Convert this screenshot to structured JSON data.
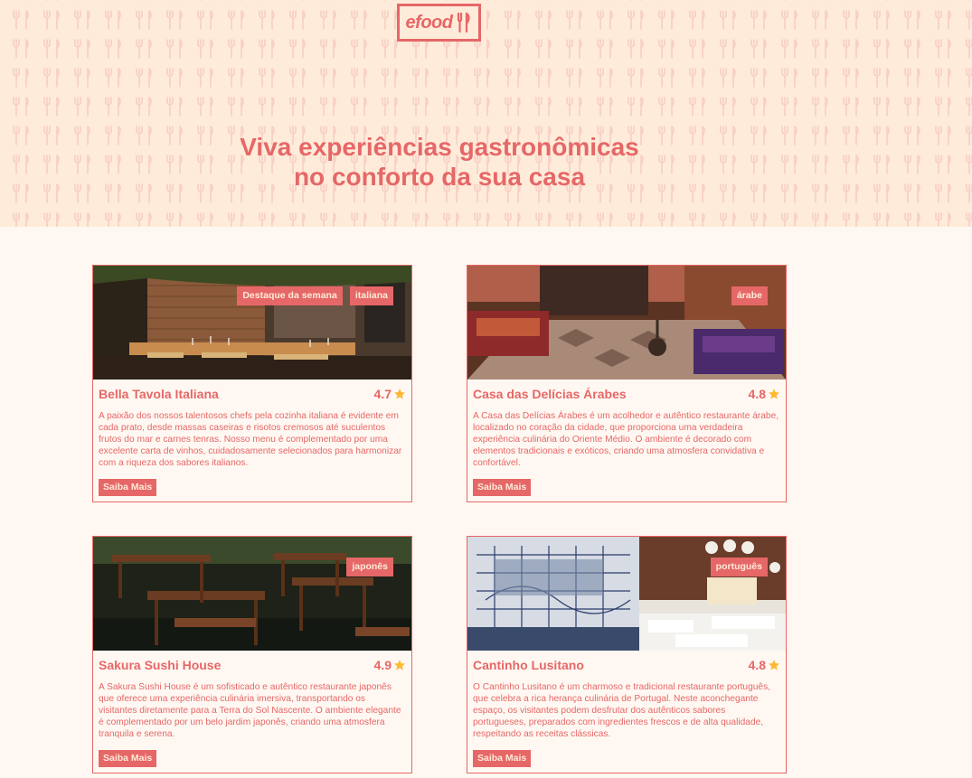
{
  "header": {
    "logo_text": "efood",
    "tagline_line1": "Viva experiências gastronômicas",
    "tagline_line2": "no conforto da sua casa"
  },
  "colors": {
    "accent": "#e66767",
    "hero_bg": "#ffebd9",
    "page_bg": "#fff8f2",
    "star": "#ffb930"
  },
  "restaurants": [
    {
      "name": "Bella Tavola Italiana",
      "rating": "4.7",
      "tags": [
        "Destaque da semana",
        "italiana"
      ],
      "description": "A paixão dos nossos talentosos chefs pela cozinha italiana é evidente em cada prato, desde massas caseiras e risotos cremosos até suculentos frutos do mar e carnes tenras. Nosso menu é complementado por uma excelente carta de vinhos, cuidadosamente selecionados para harmonizar com a riqueza dos sabores italianos.",
      "button": "Saiba Mais",
      "image": "restaurant-interior-brick-photo"
    },
    {
      "name": "Casa das Delícias Árabes",
      "rating": "4.8",
      "tags": [
        "árabe"
      ],
      "description": "A Casa das Delícias Árabes é um acolhedor e autêntico restaurante árabe, localizado no coração da cidade, que proporciona uma verdadeira experiência culinária do Oriente Médio. O ambiente é decorado com elementos tradicionais e exóticos, criando uma atmosfera convidativa e confortável.",
      "button": "Saiba Mais",
      "image": "arabic-lounge-photo"
    },
    {
      "name": "Sakura Sushi House",
      "rating": "4.9",
      "tags": [
        "japonês"
      ],
      "description": "A Sakura Sushi House é um sofisticado e autêntico restaurante japonês que oferece uma experiência culinária imersiva, transportando os visitantes diretamente para a Terra do Sol Nascente. O ambiente elegante é complementado por um belo jardim japonês, criando uma atmosfera tranquila e serena.",
      "button": "Saiba Mais",
      "image": "garden-tables-photo"
    },
    {
      "name": "Cantinho Lusitano",
      "rating": "4.8",
      "tags": [
        "português"
      ],
      "description": "O Cantinho Lusitano é um charmoso e tradicional restaurante português, que celebra a rica herança culinária de Portugal. Neste aconchegante espaço, os visitantes podem desfrutar dos autênticos sabores portugueses, preparados com ingredientes frescos e de alta qualidade, respeitando as receitas clássicas.",
      "button": "Saiba Mais",
      "image": "azulejo-dining-room-photo"
    }
  ]
}
